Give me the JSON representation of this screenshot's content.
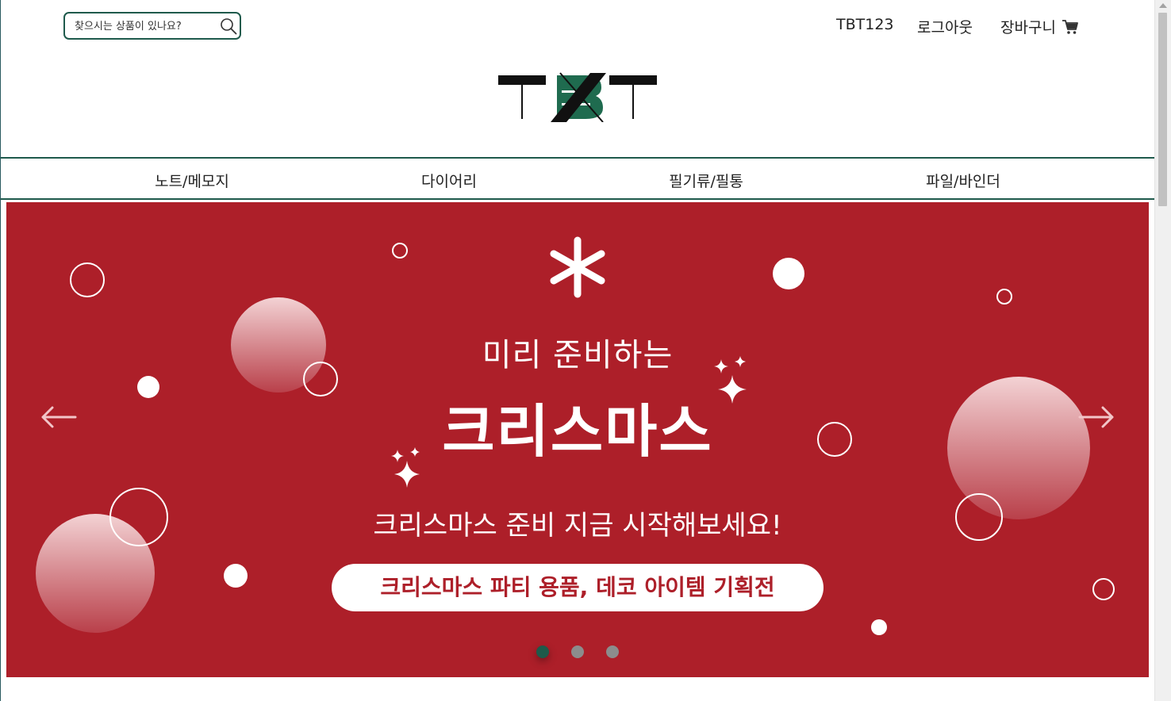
{
  "header": {
    "search_placeholder": "찾으시는 상품이 있나요?",
    "user_link": "TBT123",
    "logout_link": "로그아웃",
    "cart_link": "장바구니"
  },
  "logo_text": "TBT",
  "nav": [
    {
      "label": "노트/메모지"
    },
    {
      "label": "다이어리"
    },
    {
      "label": "필기류/필통"
    },
    {
      "label": "파일/바인더"
    }
  ],
  "banner": {
    "subtitle": "미리 준비하는",
    "title": "크리스마스",
    "description": "크리스마스 준비 지금 시작해보세요!",
    "cta": "크리스마스 파티 용품, 데코 아이템 기획전",
    "active_slide": 1,
    "slide_count": 3
  },
  "colors": {
    "brand_green": "#1f5a4c",
    "banner_red": "#ad1f29",
    "dot_active": "#1e5a4a",
    "dot_inactive": "#8c8c8c"
  },
  "icons": [
    "search-icon",
    "cart-icon",
    "arrow-left-icon",
    "arrow-right-icon",
    "snowflake-icon",
    "sparkle-icon"
  ]
}
